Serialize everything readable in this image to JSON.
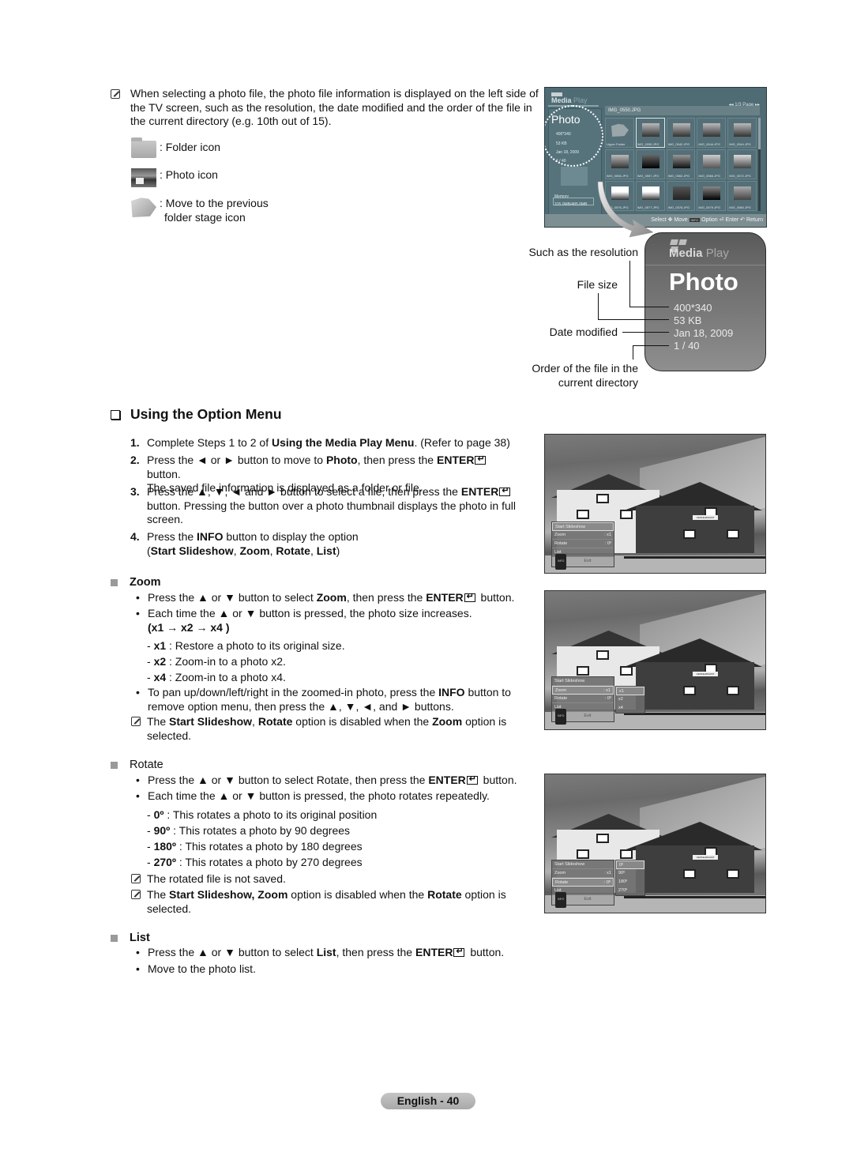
{
  "intro": {
    "note": "When selecting a photo file, the photo file information is displayed on the left side of the TV screen, such as the resolution, the date modified and the order of the file in the current directory (e.g. 10th out of 15).",
    "icons": [
      {
        "icon": "folder-icon",
        "label": ": Folder icon"
      },
      {
        "icon": "photo-icon",
        "label": ": Photo icon"
      },
      {
        "icon": "previous-folder-icon",
        "label": ": Move to the previous",
        "label2": "folder stage icon"
      }
    ]
  },
  "tv_screen": {
    "logo_media": "Media",
    "logo_play": "Play",
    "pager": "◂◂   1/3 Page   ▸▸",
    "path": "IMG_0550.JPG",
    "left_title": "Photo",
    "info": [
      "400*340",
      "53 KB",
      "Jan 18, 2009",
      "1 / 40"
    ],
    "memory_label": "Memory",
    "memory_value": "315.0MB/485.0MB",
    "thumbnails": [
      "Upper Folder",
      "IMG_0335.JPG",
      "IMG_0542.JPG",
      "IMG_0544.JPG",
      "IMG_0544.JPG",
      "IMG_0556.JPG",
      "IMG_0557.JPG",
      "IMG_0562.JPG",
      "IMG_0566.JPG",
      "IMG_0572.JPG",
      "IMG_0576.JPG",
      "IMG_0577.JPG",
      "IMG_0578.JPG",
      "IMG_0579.JPG",
      "IMG_0580.JPG"
    ],
    "bottom": {
      "select": "Select",
      "move": "Move",
      "info_key": "INFO",
      "option": "Option",
      "enter": "Enter",
      "return": "Return"
    }
  },
  "callout": {
    "logo_media": "Media",
    "logo_play": "Play",
    "title": "Photo",
    "resolution": "400*340",
    "file_size": "53 KB",
    "date": "Jan 18, 2009",
    "order": "1 / 40",
    "labels": {
      "resolution": "Such as the resolution",
      "file_size": "File size",
      "date": "Date modified",
      "order1": "Order of the file in the",
      "order2": "current directory"
    }
  },
  "section": {
    "title": "Using the Option Menu",
    "steps": [
      {
        "num": "1.",
        "pre": "Complete Steps 1 to 2 of ",
        "bold": "Using the Media Play Menu",
        "post": ". (Refer to page 38)"
      },
      {
        "num": "2.",
        "pre": "Press the ◄ or ► button to move to ",
        "bold": "Photo",
        "mid": ", then press the ",
        "bold2": "ENTER",
        "post": " button.",
        "line2": "The saved file information is displayed as a folder or file."
      },
      {
        "num": "3.",
        "pre": "Press the ▲, ▼, ◄ and ► button to select a file, then press the ",
        "bold": "ENTER",
        "line2": "button. Pressing the button over a photo thumbnail displays the photo in full",
        "line3": "screen."
      },
      {
        "num": "4.",
        "pre": "Press the ",
        "bold": "INFO",
        "post": " button to display the option",
        "line2_open": "(",
        "line2_bold": [
          "Start Slideshow",
          "Zoom",
          "Rotate",
          "List"
        ],
        "line2_close": ")"
      }
    ]
  },
  "zoom": {
    "heading": "Zoom",
    "b1_pre": "Press the ▲ or ▼ button to select ",
    "b1_bold": "Zoom",
    "b1_mid": ", then press the ",
    "b1_bold2": "ENTER",
    "b1_post": " button.",
    "b2": "Each time the ▲ or ▼ button is pressed, the photo size increases.",
    "b2_seq": "(x1 → x2 → x4 )",
    "items": [
      {
        "key": "x1",
        "desc": " : Restore a photo to its original size."
      },
      {
        "key": "x2",
        "desc": " : Zoom-in to a photo x2."
      },
      {
        "key": "x4",
        "desc": " : Zoom-in to a photo x4."
      }
    ],
    "b3_pre": "To pan up/down/left/right in the zoomed-in photo, press the ",
    "b3_bold": "INFO",
    "b3_post": " button to",
    "b3_line2": "remove option menu, then press the ▲, ▼, ◄, and ► buttons.",
    "note_pre": "The ",
    "note_bold1": "Start Slideshow",
    "note_sep": ", ",
    "note_bold2": "Rotate",
    "note_mid": " option is disabled when the ",
    "note_bold3": "Zoom",
    "note_post": " option is",
    "note_line2": "selected."
  },
  "rotate": {
    "heading": "Rotate",
    "b1_pre": "Press the ▲ or ▼ button to select Rotate, then press the ",
    "b1_bold": "ENTER",
    "b1_post": " button.",
    "b2": "Each time the ▲ or ▼ button is pressed, the photo rotates repeatedly.",
    "items": [
      {
        "key": "0º",
        "desc": " : This rotates a photo to its original position"
      },
      {
        "key": "90º",
        "desc": " : This rotates a photo by 90 degrees"
      },
      {
        "key": "180º",
        "desc": " : This rotates a photo by 180 degrees"
      },
      {
        "key": "270º",
        "desc": " : This rotates a photo by 270 degrees"
      }
    ],
    "note1": "The rotated file is not saved.",
    "note2_pre": "The ",
    "note2_bold1": "Start Slideshow, Zoom",
    "note2_mid": " option is disabled when the ",
    "note2_bold2": "Rotate",
    "note2_post": " option is",
    "note2_line2": "selected."
  },
  "list": {
    "heading": "List",
    "b1_pre": "Press the ▲ or ▼ button to select ",
    "b1_bold": "List",
    "b1_mid": ", then press the ",
    "b1_bold2": "ENTER",
    "b1_post": " button.",
    "b2": "Move to the photo list."
  },
  "osd": {
    "start_slideshow": "Start Slideshow",
    "zoom_label": "Zoom",
    "zoom_value": ": x1",
    "rotate_label": "Rotate",
    "rotate_value": ": 0º",
    "list_label": "List",
    "info_key": "INFO",
    "exit": "Exit",
    "sign": "VERKEHRSAMT",
    "zoom_options": [
      "x1",
      "x2",
      "x4"
    ],
    "rotate_options": [
      "0º",
      "90º",
      "180º",
      "270º"
    ]
  },
  "footer": {
    "page_label": "English - 40"
  }
}
